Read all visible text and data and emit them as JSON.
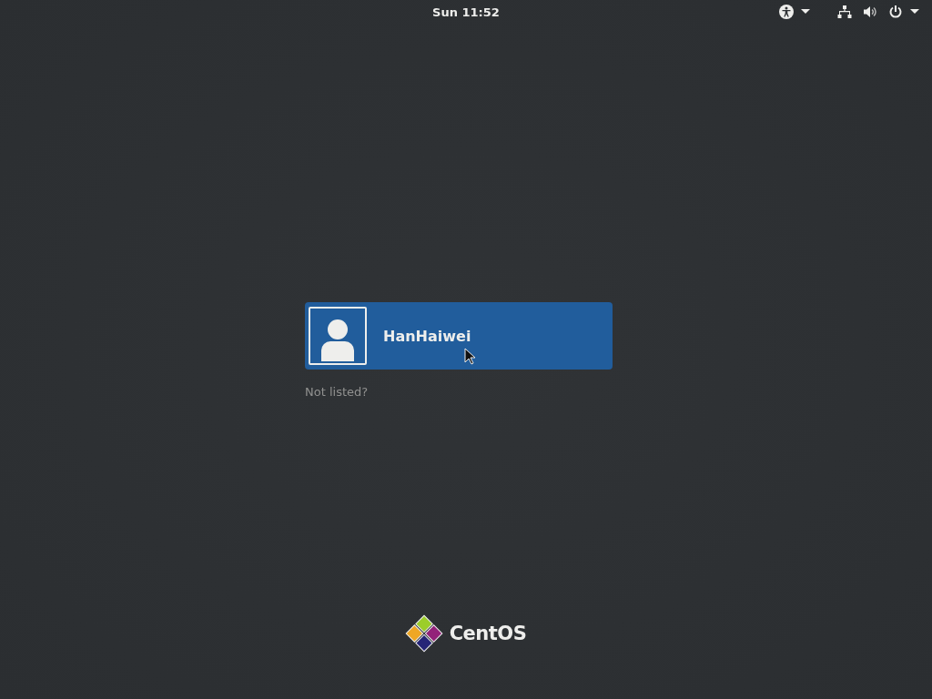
{
  "top_bar": {
    "clock": "Sun 11:52"
  },
  "users": [
    {
      "name": "HanHaiwei",
      "selected": true
    }
  ],
  "not_listed": "Not listed?",
  "logo": {
    "text": "CentOS"
  }
}
